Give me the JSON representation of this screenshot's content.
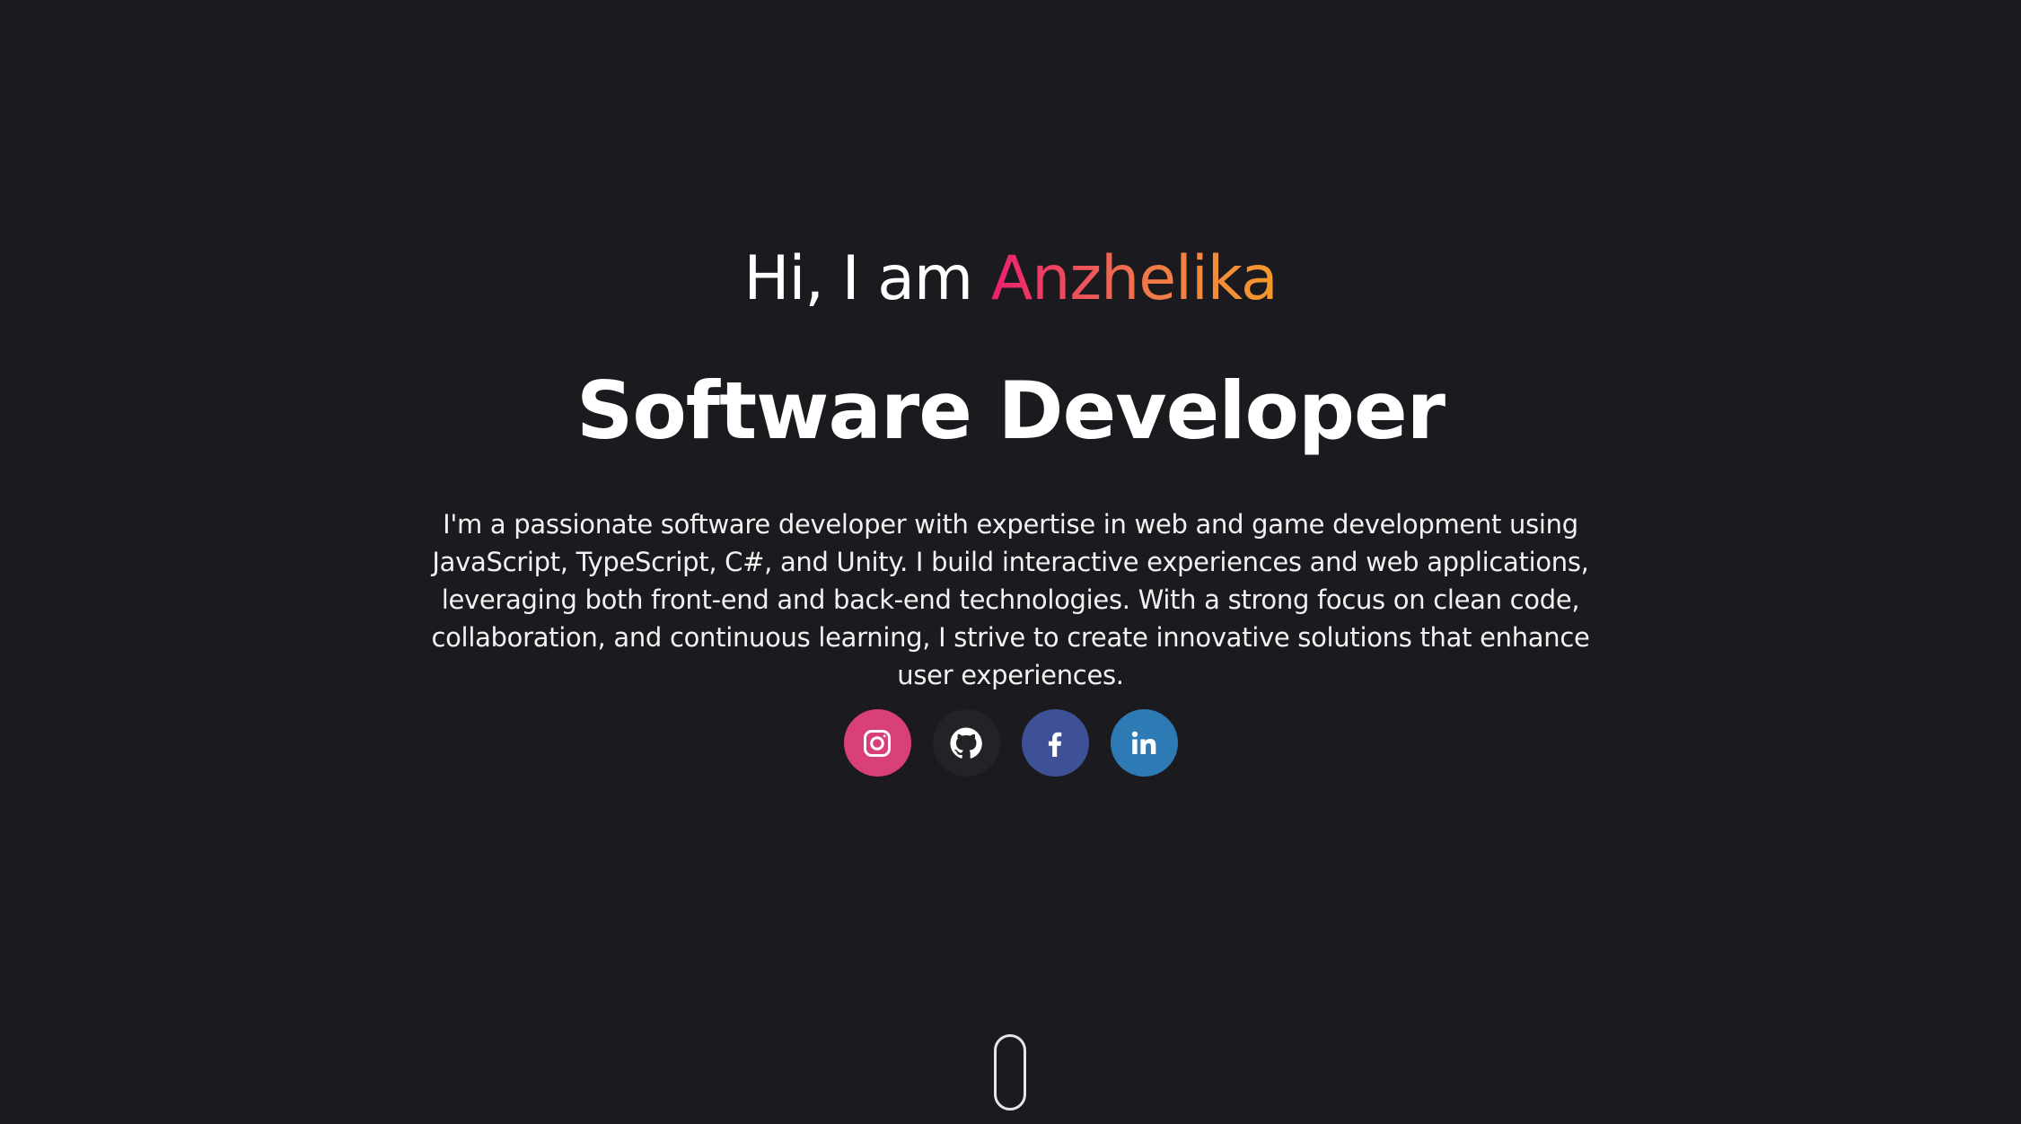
{
  "hero": {
    "greeting_prefix": "Hi, I am ",
    "name": "Anzhelika",
    "role": "Software Developer",
    "bio": "I'm a passionate software developer with expertise in web and game development using JavaScript, TypeScript, C#, and Unity. I build interactive experiences and web applications, leveraging both front-end and back-end technologies. With a strong focus on clean code, collaboration, and continuous learning, I strive to create innovative solutions that enhance user experiences."
  },
  "socials": [
    {
      "icon": "instagram-icon",
      "color": "#d93f78"
    },
    {
      "icon": "github-icon",
      "color": "#222327"
    },
    {
      "icon": "facebook-icon",
      "color": "#3e5196"
    },
    {
      "icon": "linkedin-icon",
      "color": "#2e7ab5"
    }
  ],
  "colors": {
    "background": "#1b1a1f",
    "name_gradient_start": "#ed1f6e",
    "name_gradient_end": "#f49a2b"
  }
}
